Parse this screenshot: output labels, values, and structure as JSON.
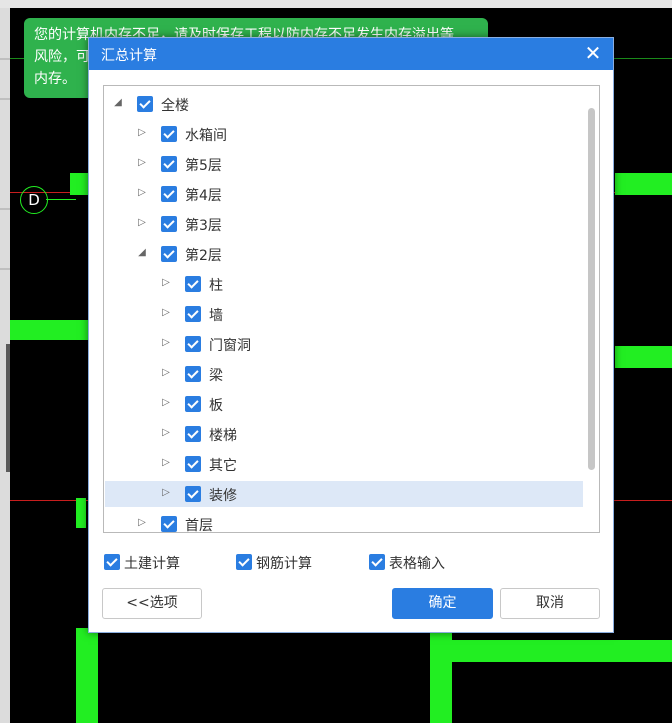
{
  "toast": {
    "line1": "您的计算机内存不足，请及时保存工程以防内存不足发生内存溢出等",
    "line2": "风险，可",
    "line3": "内存。"
  },
  "cad": {
    "axis_label": "D",
    "wall_color": "#22ee22",
    "axis_line_color": "#c81e1e"
  },
  "dialog": {
    "title": "汇总计算",
    "close_glyph": "✕",
    "tree": [
      {
        "label": "全楼",
        "expanded": true,
        "checked": true
      },
      {
        "label": "水箱间",
        "expanded": false,
        "checked": true
      },
      {
        "label": "第5层",
        "expanded": false,
        "checked": true
      },
      {
        "label": "第4层",
        "expanded": false,
        "checked": true
      },
      {
        "label": "第3层",
        "expanded": false,
        "checked": true
      },
      {
        "label": "第2层",
        "expanded": true,
        "checked": true
      },
      {
        "label": "柱",
        "expanded": false,
        "checked": true
      },
      {
        "label": "墙",
        "expanded": false,
        "checked": true
      },
      {
        "label": "门窗洞",
        "expanded": false,
        "checked": true
      },
      {
        "label": "梁",
        "expanded": false,
        "checked": true
      },
      {
        "label": "板",
        "expanded": false,
        "checked": true
      },
      {
        "label": "楼梯",
        "expanded": false,
        "checked": true
      },
      {
        "label": "其它",
        "expanded": false,
        "checked": true
      },
      {
        "label": "装修",
        "expanded": false,
        "checked": true,
        "selected": true
      },
      {
        "label": "首层",
        "expanded": false,
        "checked": true
      }
    ],
    "options": {
      "civil": "土建计算",
      "rebar": "钢筋计算",
      "table": "表格输入"
    },
    "buttons": {
      "options": "<<选项",
      "ok": "确定",
      "cancel": "取消"
    },
    "accent_color": "#2a7de1"
  }
}
